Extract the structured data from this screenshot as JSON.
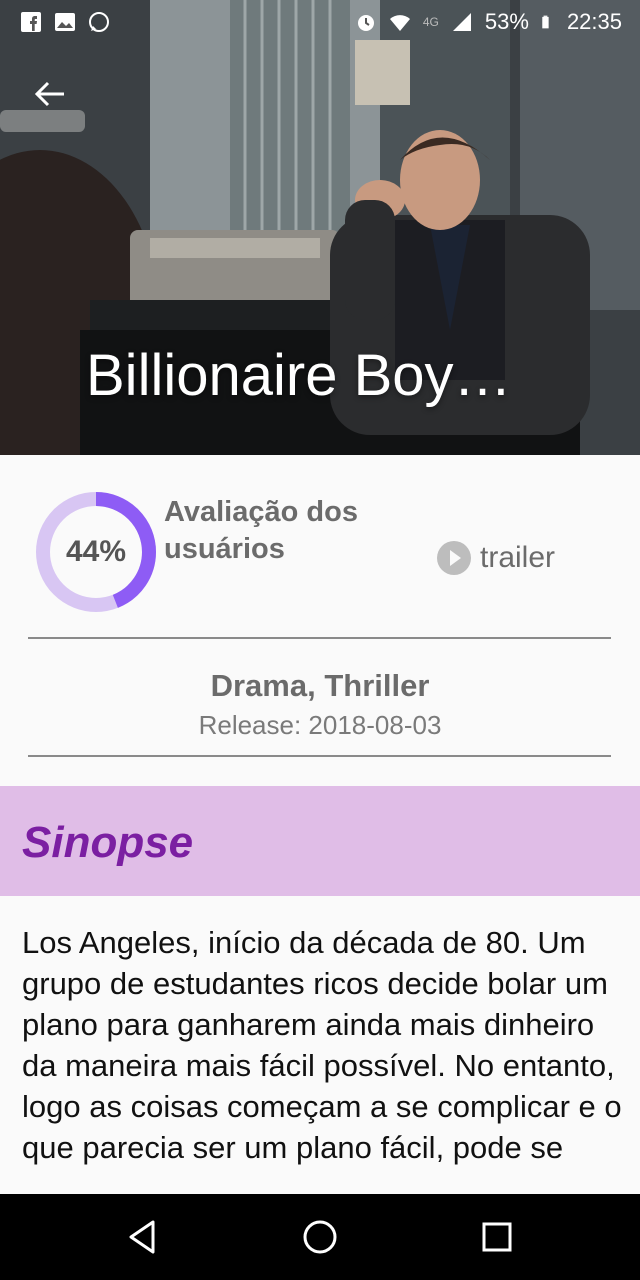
{
  "status_bar": {
    "battery": "53%",
    "time": "22:35",
    "network": "4G",
    "icons": [
      "facebook-icon",
      "gallery-icon",
      "whatsapp-icon",
      "alarm-icon",
      "wifi-icon",
      "signal-icon",
      "battery-icon"
    ]
  },
  "movie": {
    "title": "Billionaire Boy…",
    "rating_percent": "44%",
    "rating_value": 0.44,
    "rating_label": "Avaliação dos usuários",
    "trailer_label": "trailer",
    "genres": "Drama, Thriller",
    "release": "Release: 2018-08-03"
  },
  "synopsis": {
    "heading": "Sinopse",
    "text": "Los Angeles, início da década de 80. Um grupo de estudantes ricos decide bolar um plano para ganharem ainda mais dinheiro da maneira mais fácil possível. No entanto, logo as coisas começam a se complicar e o que parecia ser um plano fácil, pode se"
  },
  "colors": {
    "accent": "#7b1fa2",
    "sinopse_bg": "#e0bde7",
    "ring_fill": "#8e5cf5",
    "ring_track": "#d8c6f3"
  }
}
